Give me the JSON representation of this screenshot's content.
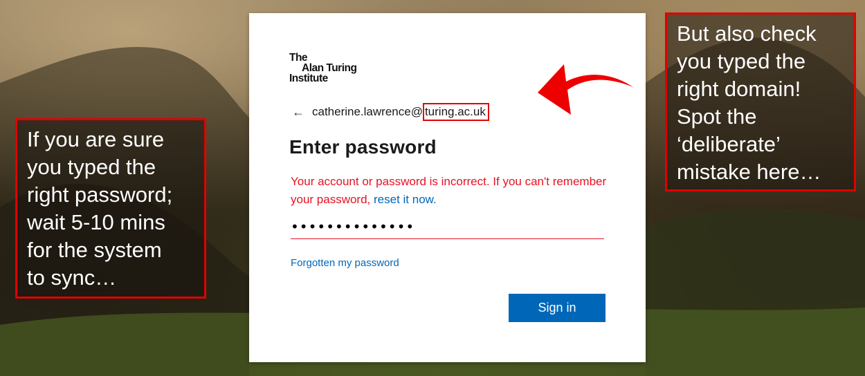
{
  "logo": {
    "line1": "The",
    "line2": "Alan Turing",
    "line3": "Institute"
  },
  "identity": {
    "back_icon": "←",
    "email_prefix": "catherine.lawrence@",
    "email_domain": "turing.ac.uk"
  },
  "form": {
    "title": "Enter password",
    "error_text": "Your account or password is incorrect. If you can't remember your password, ",
    "error_link": "reset it now.",
    "password_value": "••••••••••••••",
    "forgot_link": "Forgotten my password",
    "signin_label": "Sign in"
  },
  "annotations": {
    "left_lines": [
      "If you are sure",
      "you typed the",
      "right password;",
      "wait 5-10 mins",
      "for the system",
      "to sync…"
    ],
    "right_lines": [
      "But also check",
      "you typed the",
      "right domain!",
      "Spot the",
      "‘deliberate’",
      "mistake here…"
    ]
  },
  "colors": {
    "accent": "#0067b8",
    "error": "#e81123",
    "highlight": "#e00000"
  }
}
